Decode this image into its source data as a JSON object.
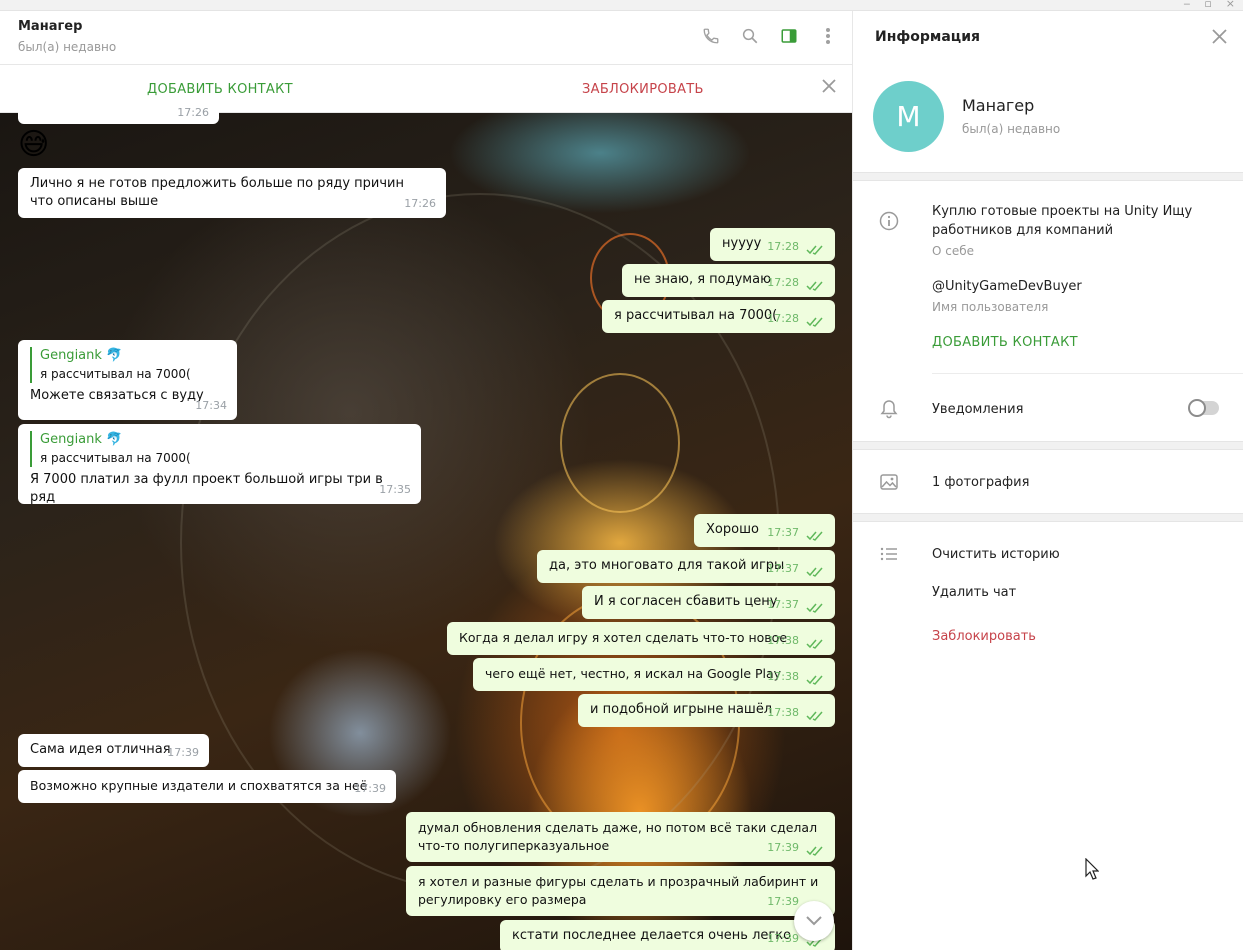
{
  "chat": {
    "peer_name": "Манагер",
    "peer_status": "был(а) недавно",
    "add_contact": "ДОБАВИТЬ КОНТАКТ",
    "block": "ЗАБЛОКИРОВАТЬ",
    "messages": [
      {
        "dir": "in",
        "text": "",
        "time": "17:26"
      },
      {
        "dir": "in",
        "text": "Лично я не готов предложить больше по ряду причин что описаны выше",
        "time": "17:26"
      },
      {
        "dir": "out",
        "text": "нуууу",
        "time": "17:28"
      },
      {
        "dir": "out",
        "text": "не знаю, я подумаю",
        "time": "17:28"
      },
      {
        "dir": "out",
        "text": "я рассчитывал на 7000(",
        "time": "17:28"
      },
      {
        "dir": "in",
        "reply_name": "Gengiank 🐬",
        "reply_text": "я рассчитывал на 7000(",
        "text": "Можете связаться с вуду",
        "time": "17:34"
      },
      {
        "dir": "in",
        "reply_name": "Gengiank 🐬",
        "reply_text": "я рассчитывал на 7000(",
        "text": "Я 7000 платил за фулл проект большой игры три в ряд",
        "time": "17:35"
      },
      {
        "dir": "out",
        "text": "Хорошо",
        "time": "17:37"
      },
      {
        "dir": "out",
        "text": "да, это многовато для такой игры",
        "time": "17:37"
      },
      {
        "dir": "out",
        "text": "И я согласен сбавить цену",
        "time": "17:37"
      },
      {
        "dir": "out",
        "text": "Когда я делал игру я хотел сделать что-то новое",
        "time": "17:38"
      },
      {
        "dir": "out",
        "text": "чего ещё нет, честно, я искал на Google Play",
        "time": "17:38"
      },
      {
        "dir": "out",
        "text": "и подобной игрыне нашёл",
        "time": "17:38"
      },
      {
        "dir": "in",
        "text": "Сама идея отличная",
        "time": "17:39"
      },
      {
        "dir": "in",
        "text": "Возможно крупные издатели и спохватятся за неё",
        "time": "17:39"
      },
      {
        "dir": "out",
        "text": "думал обновления сделать даже, но потом всё таки сделал что-то полугиперказуальное",
        "time": "17:39"
      },
      {
        "dir": "out",
        "text": "я хотел и разные фигуры сделать и прозрачный лабиринт и регулировку его размера",
        "time": "17:39"
      },
      {
        "dir": "out",
        "text": "кстати последнее делается очень легко",
        "time": "17:39"
      }
    ]
  },
  "info": {
    "title": "Информация",
    "avatar_letter": "М",
    "name": "Манагер",
    "status": "был(а) недавно",
    "bio": "Куплю готовые проекты на Unity Ищу работников для компаний",
    "bio_label": "О себе",
    "username": "@UnityGameDevBuyer",
    "username_label": "Имя пользователя",
    "add_contact": "ДОБАВИТЬ КОНТАКТ",
    "notifications": "Уведомления",
    "notifications_on": false,
    "photos": "1 фотография",
    "clear_history": "Очистить историю",
    "delete_chat": "Удалить чат",
    "block": "Заблокировать"
  },
  "colors": {
    "accent_green": "#3a9c38",
    "danger_red": "#c6434a",
    "avatar": "#6ecfcb",
    "out_bubble": "#effdde"
  }
}
